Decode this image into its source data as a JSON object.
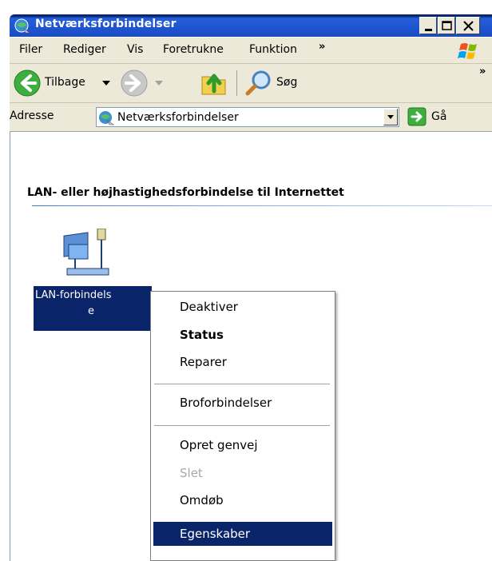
{
  "window": {
    "title": "Netværksforbindelser"
  },
  "menubar": {
    "items": [
      "Filer",
      "Rediger",
      "Vis",
      "Foretrukne",
      "Funktion"
    ],
    "more": "»"
  },
  "toolbar": {
    "back_label": "Tilbage",
    "search_label": "Søg",
    "more": "»"
  },
  "address": {
    "label": "Adresse",
    "value": "Netværksforbindelser",
    "go_label": "Gå"
  },
  "content": {
    "group_heading": "LAN- eller højhastighedsforbindelse til Internettet",
    "connection": {
      "label_line1": "LAN-forbindels",
      "label_line2": "e"
    }
  },
  "context_menu": {
    "items": [
      "Deaktiver",
      "Status",
      "Reparer",
      "Broforbindelser",
      "Opret genvej",
      "Slet",
      "Omdøb",
      "Egenskaber"
    ]
  },
  "colors": {
    "selection": "#0a246a",
    "titlebar": "#245edb",
    "chrome": "#ece9d8"
  }
}
